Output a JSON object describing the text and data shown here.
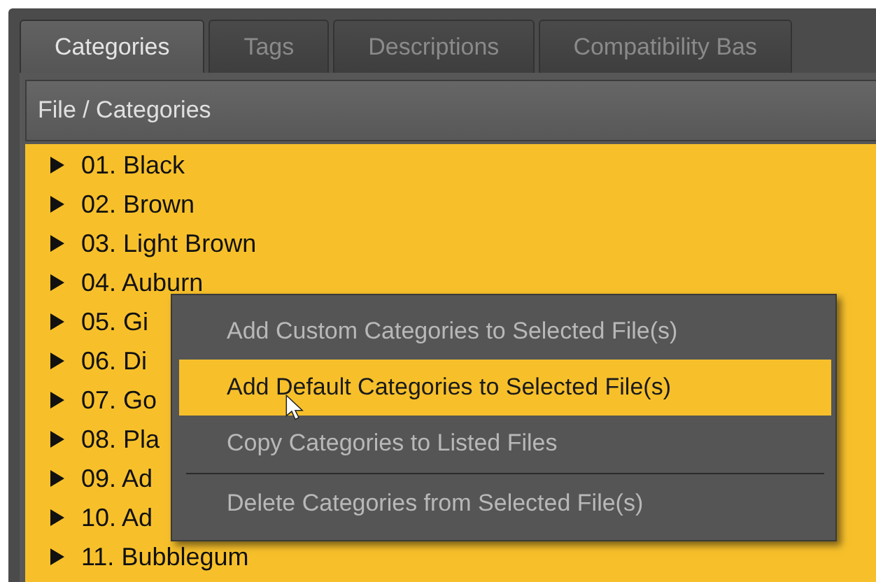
{
  "tabs": [
    {
      "label": "Categories",
      "selected": true
    },
    {
      "label": "Tags",
      "selected": false
    },
    {
      "label": "Descriptions",
      "selected": false
    },
    {
      "label": "Compatibility Bas",
      "selected": false
    }
  ],
  "tree": {
    "header": "File / Categories",
    "items": [
      {
        "label": "01. Black",
        "expanded": false
      },
      {
        "label": "02. Brown",
        "expanded": false
      },
      {
        "label": "03. Light Brown",
        "expanded": false
      },
      {
        "label": "04. Auburn",
        "expanded": false
      },
      {
        "label": "05. Gi",
        "expanded": false
      },
      {
        "label": "06. Di",
        "expanded": false
      },
      {
        "label": "07. Go",
        "expanded": false
      },
      {
        "label": "08. Pla",
        "expanded": false
      },
      {
        "label": "09. Ad",
        "expanded": false
      },
      {
        "label": "10. Ad",
        "expanded": false
      },
      {
        "label": "11. Bubblegum",
        "expanded": false
      }
    ]
  },
  "context_menu": {
    "items": [
      {
        "kind": "item",
        "label": "Add Custom Categories to Selected File(s)",
        "selected": false
      },
      {
        "kind": "item",
        "label": "Add Default Categories to Selected File(s)",
        "selected": true
      },
      {
        "kind": "item",
        "label": "Copy Categories to Listed Files",
        "selected": false
      },
      {
        "kind": "separator"
      },
      {
        "kind": "item",
        "label": "Delete Categories from Selected File(s)",
        "selected": false
      }
    ]
  }
}
